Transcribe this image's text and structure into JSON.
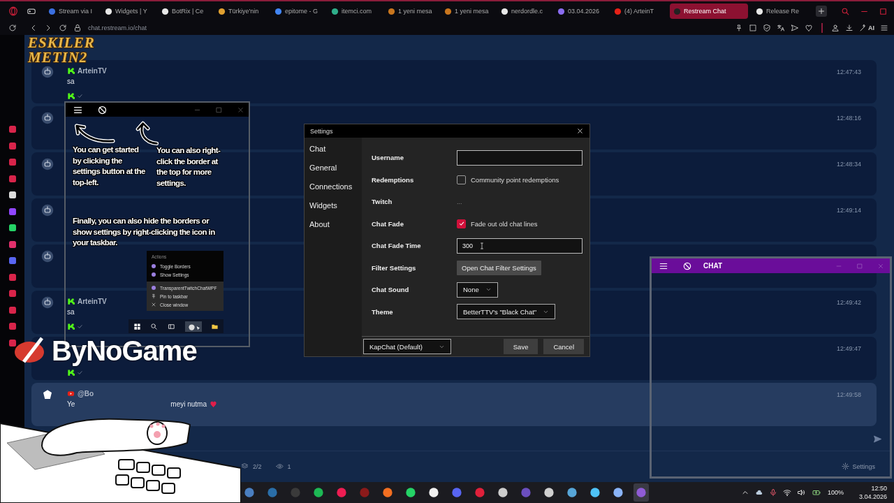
{
  "browser": {
    "tabs": [
      {
        "label": "Stream via I",
        "color": "#3b6fe0",
        "selected": false
      },
      {
        "label": "Widgets | Y",
        "color": "#e8e8e8",
        "selected": false
      },
      {
        "label": "BotRix | Ce",
        "color": "#e8e8e8",
        "selected": false
      },
      {
        "label": "Türkiye'nin",
        "color": "#e0a030",
        "selected": false
      },
      {
        "label": "epitome - G",
        "color": "#4285f4",
        "selected": false
      },
      {
        "label": "itemci.com",
        "color": "#2fae8a",
        "selected": false
      },
      {
        "label": "1 yeni mesa",
        "color": "#c9761e",
        "selected": false
      },
      {
        "label": "1 yeni mesa",
        "color": "#c9761e",
        "selected": false
      },
      {
        "label": "nerdordle.c",
        "color": "#e8e8e8",
        "selected": false
      },
      {
        "label": "03.04.2026",
        "color": "#8a6cf0",
        "selected": false
      },
      {
        "label": "(4) ArteinT",
        "color": "#e62117",
        "selected": false
      },
      {
        "label": "Restream Chat",
        "color": "#222222",
        "selected": true
      },
      {
        "label": "Release Re",
        "color": "#e8e8e8",
        "selected": false
      }
    ],
    "address": "chat.restream.io/chat",
    "ai_label": "AI"
  },
  "sidebar": {
    "icons": [
      {
        "color": "#d8244a"
      },
      {
        "color": "#d8244a"
      },
      {
        "color": "#d8244a"
      },
      {
        "color": "#d8244a"
      },
      {
        "color": "#dddddd"
      },
      {
        "color": "#9146ff"
      },
      {
        "color": "#25d366"
      },
      {
        "color": "#e1306c"
      },
      {
        "color": "#5865f2"
      },
      {
        "color": "#d8244a"
      },
      {
        "color": "#d8244a"
      },
      {
        "color": "#d8244a"
      },
      {
        "color": "#d8244a"
      },
      {
        "color": "#d8244a"
      }
    ]
  },
  "chat": {
    "messages": [
      {
        "avatar": {
          "kind": "robot"
        },
        "source": {
          "kind": "kick"
        },
        "name": "ArteinTV",
        "message_parts": [
          "sa"
        ],
        "badge": true,
        "time": "12:47:43",
        "highlighted": false
      },
      {
        "avatar": {
          "kind": "robot"
        },
        "badge": false,
        "time": "12:48:16",
        "highlighted": false
      },
      {
        "avatar": {
          "kind": "robot"
        },
        "badge": false,
        "time": "12:48:34",
        "highlighted": false
      },
      {
        "avatar": {
          "kind": "robot"
        },
        "badge": false,
        "time": "12:49:14",
        "highlighted": false
      },
      {
        "avatar": {
          "kind": "robot"
        },
        "badge": false,
        "highlighted": false
      },
      {
        "avatar": {
          "kind": "robot"
        },
        "source": {
          "kind": "kick"
        },
        "name": "ArteinTV",
        "message_parts": [
          "sa"
        ],
        "badge": true,
        "time": "12:49:42",
        "highlighted": false
      },
      {
        "badge": true,
        "time": "12:49:47",
        "highlighted": false
      },
      {
        "avatar": {
          "kind": "logo"
        },
        "source": {
          "kind": "youtube"
        },
        "name": "@Bo",
        "message_parts": [
          "Ye",
          "meyi nutma"
        ],
        "heart": true,
        "badge": false,
        "time": "12:49:58",
        "highlighted": true
      }
    ],
    "footer": {
      "queue": "2/2",
      "viewers": "1",
      "settings": "Settings"
    }
  },
  "overlays": {
    "logo_top": [
      "ESKILER",
      "METIN2"
    ],
    "logo_bottom": "ByNoGame"
  },
  "tutorial_window": {
    "notes": [
      "You can get started by clicking the settings button at the top-left.",
      "You can also right-click the border at the top for more settings.",
      "Finally, you can also hide the borders or show settings by right-clicking the icon in your taskbar."
    ],
    "menu": {
      "header": "Actions",
      "top_items": [
        {
          "kind": "app",
          "label": "Toggle Borders"
        },
        {
          "kind": "app",
          "label": "Show Settings"
        }
      ],
      "bottom_items": [
        {
          "kind": "app",
          "label": "TransparentTwitchChatWPF"
        },
        {
          "kind": "pin",
          "label": "Pin to taskbar"
        },
        {
          "kind": "close",
          "label": "Close window"
        }
      ]
    }
  },
  "settings_dialog": {
    "title": "Settings",
    "nav": [
      "Chat",
      "General",
      "Connections",
      "Widgets",
      "About"
    ],
    "rows": [
      {
        "kind": "input",
        "label": "Username"
      },
      {
        "kind": "checkbox",
        "label": "Redemptions",
        "text": "Community point redemptions",
        "checked": false
      },
      {
        "kind": "text",
        "label": "Twitch",
        "value": "..."
      },
      {
        "kind": "checkbox",
        "label": "Chat Fade",
        "text": "Fade out old chat lines",
        "checked": true
      },
      {
        "kind": "input",
        "label": "Chat Fade Time",
        "value": "300",
        "cursor": true
      },
      {
        "kind": "button",
        "label": "Filter Settings",
        "text": "Open Chat Filter Settings"
      },
      {
        "kind": "dropdown",
        "label": "Chat Sound",
        "value": "None"
      },
      {
        "kind": "dropdown",
        "label": "Theme",
        "value": "BetterTTV's \"Black Chat\""
      }
    ],
    "preset": "KapChat (Default)",
    "buttons": [
      "Save",
      "Cancel"
    ]
  },
  "chat_window": {
    "title": "CHAT"
  },
  "taskbar": {
    "apps": [
      {
        "color": "#4a7fc1",
        "selected": false
      },
      {
        "color": "#2a6ea8",
        "selected": false
      },
      {
        "color": "#3a3a3a",
        "selected": false
      },
      {
        "color": "#1db954",
        "selected": false
      },
      {
        "color": "#ee1d52",
        "selected": false
      },
      {
        "color": "#8b1a1a",
        "selected": false
      },
      {
        "color": "#f36f21",
        "selected": false
      },
      {
        "color": "#25d366",
        "selected": false
      },
      {
        "color": "#f0f0f0",
        "selected": false
      },
      {
        "color": "#5865f2",
        "selected": false
      },
      {
        "color": "#e0203a",
        "selected": false
      },
      {
        "color": "#cccccc",
        "selected": false
      },
      {
        "color": "#6b4fbf",
        "selected": false
      },
      {
        "color": "#d0d0d0",
        "selected": false
      },
      {
        "color": "#57a6d8",
        "selected": false
      },
      {
        "color": "#4fc3f7",
        "selected": false
      },
      {
        "color": "#8ab4f8",
        "selected": false
      },
      {
        "color": "#8f5bd6",
        "selected": true
      }
    ],
    "battery": "100%",
    "time": "12:50",
    "date": "3.04.2026"
  }
}
